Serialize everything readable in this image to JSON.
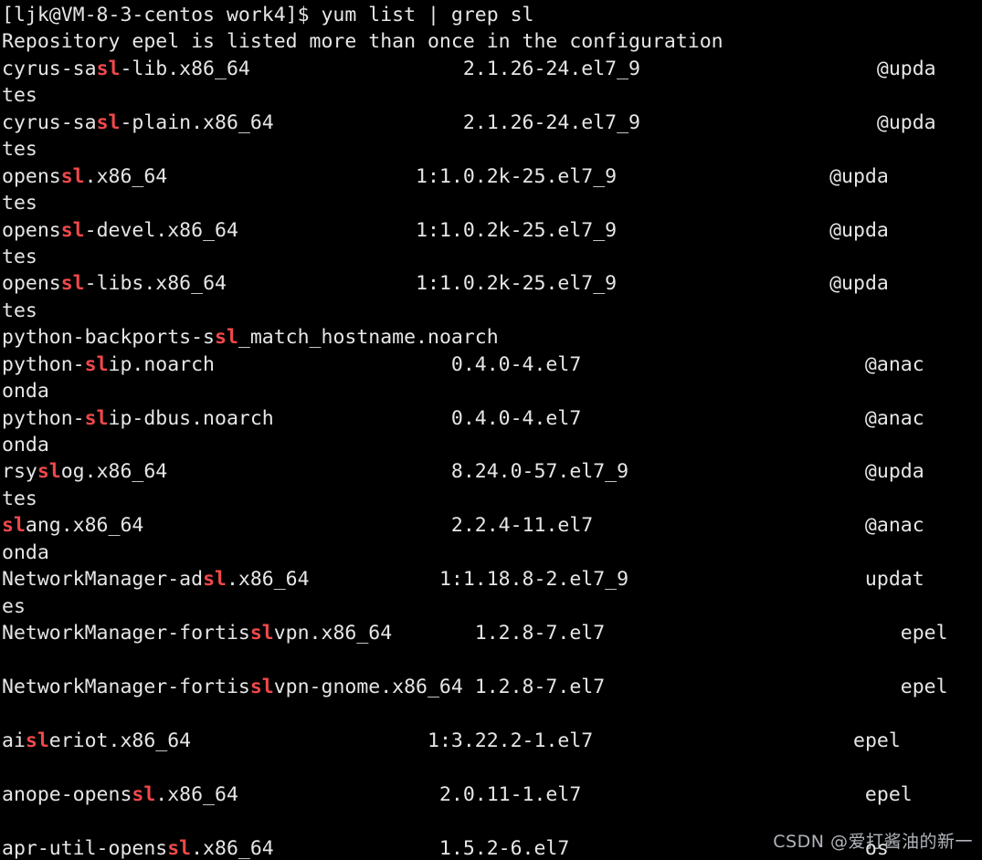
{
  "terminal": {
    "background_color": "#000000",
    "text_color": "#e6e6e6",
    "match_color": "#f0484a",
    "prompt": "[ljk@VM-8-3-centos work4]$",
    "command": "yum list | grep sl",
    "warning": "Repository epel is listed more than once in the configuration",
    "columns": {
      "name_col": 0,
      "version_col": 40,
      "repo_col": 68
    },
    "lines": [
      {
        "type": "prompt",
        "segments": [
          {
            "t": "[ljk@VM-8-3-centos work4]$ yum list | grep ",
            "m": false
          },
          {
            "t": "sl",
            "m": false
          }
        ]
      },
      {
        "type": "text",
        "segments": [
          {
            "t": "Repository epel is listed more than once in the configuration",
            "m": false
          }
        ]
      },
      {
        "type": "text",
        "segments": [
          {
            "t": "cyrus-sa",
            "m": false
          },
          {
            "t": "sl",
            "m": true
          },
          {
            "t": "-lib.x86_64",
            "m": false
          },
          {
            "t": "                  2.1.26-24.el7_9                    @upda",
            "m": false
          }
        ]
      },
      {
        "type": "text",
        "segments": [
          {
            "t": "tes",
            "m": false
          }
        ]
      },
      {
        "type": "text",
        "segments": [
          {
            "t": "cyrus-sa",
            "m": false
          },
          {
            "t": "sl",
            "m": true
          },
          {
            "t": "-plain.x86_64",
            "m": false
          },
          {
            "t": "                2.1.26-24.el7_9                    @upda",
            "m": false
          }
        ]
      },
      {
        "type": "text",
        "segments": [
          {
            "t": "tes",
            "m": false
          }
        ]
      },
      {
        "type": "text",
        "segments": [
          {
            "t": "opens",
            "m": false
          },
          {
            "t": "sl",
            "m": true
          },
          {
            "t": ".x86_64",
            "m": false
          },
          {
            "t": "                     1:1.0.2k-25.el7_9                  @upda",
            "m": false
          }
        ]
      },
      {
        "type": "text",
        "segments": [
          {
            "t": "tes",
            "m": false
          }
        ]
      },
      {
        "type": "text",
        "segments": [
          {
            "t": "opens",
            "m": false
          },
          {
            "t": "sl",
            "m": true
          },
          {
            "t": "-devel.x86_64",
            "m": false
          },
          {
            "t": "               1:1.0.2k-25.el7_9                  @upda",
            "m": false
          }
        ]
      },
      {
        "type": "text",
        "segments": [
          {
            "t": "tes",
            "m": false
          }
        ]
      },
      {
        "type": "text",
        "segments": [
          {
            "t": "opens",
            "m": false
          },
          {
            "t": "sl",
            "m": true
          },
          {
            "t": "-libs.x86_64",
            "m": false
          },
          {
            "t": "                1:1.0.2k-25.el7_9                  @upda",
            "m": false
          }
        ]
      },
      {
        "type": "text",
        "segments": [
          {
            "t": "tes",
            "m": false
          }
        ]
      },
      {
        "type": "text",
        "segments": [
          {
            "t": "python-backports-s",
            "m": false
          },
          {
            "t": "sl",
            "m": true
          },
          {
            "t": "_match_hostname.noarch",
            "m": false
          }
        ]
      },
      {
        "type": "text",
        "segments": [
          {
            "t": "python-",
            "m": false
          },
          {
            "t": "sl",
            "m": true
          },
          {
            "t": "ip.noarch",
            "m": false
          },
          {
            "t": "                    0.4.0-4.el7                        @anac",
            "m": false
          }
        ]
      },
      {
        "type": "text",
        "segments": [
          {
            "t": "onda",
            "m": false
          }
        ]
      },
      {
        "type": "text",
        "segments": [
          {
            "t": "python-",
            "m": false
          },
          {
            "t": "sl",
            "m": true
          },
          {
            "t": "ip-dbus.noarch",
            "m": false
          },
          {
            "t": "               0.4.0-4.el7                        @anac",
            "m": false
          }
        ]
      },
      {
        "type": "text",
        "segments": [
          {
            "t": "onda",
            "m": false
          }
        ]
      },
      {
        "type": "text",
        "segments": [
          {
            "t": "rsy",
            "m": false
          },
          {
            "t": "sl",
            "m": true
          },
          {
            "t": "og.x86_64",
            "m": false
          },
          {
            "t": "                        8.24.0-57.el7_9                    @upda",
            "m": false
          }
        ]
      },
      {
        "type": "text",
        "segments": [
          {
            "t": "tes",
            "m": false
          }
        ]
      },
      {
        "type": "text",
        "segments": [
          {
            "t": "sl",
            "m": true
          },
          {
            "t": "ang.x86_64",
            "m": false
          },
          {
            "t": "                          2.2.4-11.el7                       @anac",
            "m": false
          }
        ]
      },
      {
        "type": "text",
        "segments": [
          {
            "t": "onda",
            "m": false
          }
        ]
      },
      {
        "type": "text",
        "segments": [
          {
            "t": "NetworkManager-ad",
            "m": false
          },
          {
            "t": "sl",
            "m": true
          },
          {
            "t": ".x86_64",
            "m": false
          },
          {
            "t": "           1:1.18.8-2.el7_9                    updat",
            "m": false
          }
        ]
      },
      {
        "type": "text",
        "segments": [
          {
            "t": "es",
            "m": false
          }
        ]
      },
      {
        "type": "text",
        "segments": [
          {
            "t": "NetworkManager-fortis",
            "m": false
          },
          {
            "t": "sl",
            "m": true
          },
          {
            "t": "vpn.x86_64",
            "m": false
          },
          {
            "t": "       1.2.8-7.el7                         epel",
            "m": false
          }
        ]
      },
      {
        "type": "blank",
        "segments": []
      },
      {
        "type": "text",
        "segments": [
          {
            "t": "NetworkManager-fortis",
            "m": false
          },
          {
            "t": "sl",
            "m": true
          },
          {
            "t": "vpn-gnome.x86_64",
            "m": false
          },
          {
            "t": " 1.2.8-7.el7                         epel",
            "m": false
          }
        ]
      },
      {
        "type": "blank",
        "segments": []
      },
      {
        "type": "text",
        "segments": [
          {
            "t": "ai",
            "m": false
          },
          {
            "t": "sl",
            "m": true
          },
          {
            "t": "eriot.x86_64",
            "m": false
          },
          {
            "t": "                    1:3.22.2-1.el7                      epel",
            "m": false
          }
        ]
      },
      {
        "type": "blank",
        "segments": []
      },
      {
        "type": "text",
        "segments": [
          {
            "t": "anope-opens",
            "m": false
          },
          {
            "t": "sl",
            "m": true
          },
          {
            "t": ".x86_64",
            "m": false
          },
          {
            "t": "                 2.0.11-1.el7                        epel",
            "m": false
          }
        ]
      },
      {
        "type": "blank",
        "segments": []
      },
      {
        "type": "text",
        "segments": [
          {
            "t": "apr-util-opens",
            "m": false
          },
          {
            "t": "sl",
            "m": true
          },
          {
            "t": ".x86_64",
            "m": false
          },
          {
            "t": "              1.5.2-6.el7                         os",
            "m": false
          }
        ]
      }
    ]
  },
  "watermark": {
    "text": "CSDN @爱打酱油的新一"
  }
}
